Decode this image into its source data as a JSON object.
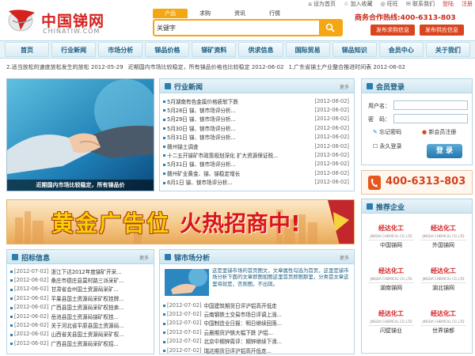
{
  "topbar": {
    "items": [
      "设为首页",
      "加入收藏",
      "旺旺",
      "联系我们",
      "登陆",
      "注册"
    ]
  },
  "logo": {
    "cn": "中国锑网",
    "en": "CHINATIW.COM"
  },
  "search": {
    "tabs": [
      "产品",
      "求购",
      "资讯",
      "行情"
    ],
    "value": "关键字"
  },
  "hotline": "商务合作热线:400-6313-803",
  "buttons": {
    "post_buy": "发布求购信息",
    "post_sell": "发布供应信息"
  },
  "nav": [
    "首页",
    "行业新闻",
    "市场分析",
    "锑品价格",
    "锑矿资料",
    "供求信息",
    "国际贸易",
    "锑品知识",
    "会员中心",
    "关于我们"
  ],
  "newsbar": [
    "2.适当放松的速度放松发生的放松 2012-05-29",
    "近期国内市场比较稳定，所有锑品价格也比较稳定 2012-06-02",
    "1.广东省锑土产业整合推进时间表 2012-06-02"
  ],
  "feature": {
    "caption": "近期国内市场比较稳定，所有锑品价"
  },
  "industry": {
    "title": "行业新闻",
    "more": "更多",
    "items": [
      {
        "t": "5月湖南有色金属价格疲软下跌",
        "d": "[2012-06-02]"
      },
      {
        "t": "5月28日 锑、镁市场评分析...",
        "d": "[2012-06-02]"
      },
      {
        "t": "5月29日 锑、镁市场评分析...",
        "d": "[2012-06-02]"
      },
      {
        "t": "5月30日 锑、镁市场评分析...",
        "d": "[2012-06-02]"
      },
      {
        "t": "5月31日 锑、镁市场评分析...",
        "d": "[2012-06-02]"
      },
      {
        "t": "赣州锑土调查",
        "d": "[2012-06-02]"
      },
      {
        "t": "十二五开锑矿市政策规划深化 扩大资源保证税...",
        "d": "[2012-06-02]"
      },
      {
        "t": "5月31日 锑、镁市场评分析...",
        "d": "[2012-06-02]"
      },
      {
        "t": "赣州矿业黄金、锑、锑稳定增长",
        "d": "[2012-06-02]"
      },
      {
        "t": "6月1日 锑、镁市场评分析...",
        "d": "[2012-06-02]"
      }
    ]
  },
  "member": {
    "title": "会员登录",
    "username_label": "用户名：",
    "password_label": "密　码：",
    "forgot": "忘记密码",
    "register": "新会员注册",
    "remember": "永久登录",
    "login": "登 录"
  },
  "phone": "400-6313-803",
  "banner": {
    "text1": "黄金广告位",
    "text2": "火热招商中!"
  },
  "recommend": {
    "title": "推荐企业",
    "logo_main": "经达化工",
    "logo_sub": "JINGDA CHEMICAL CO.,LTD",
    "companies": [
      "中国锑网",
      "外国锑网",
      "湖南锑网",
      "湖北锑网",
      "闪壁锑业",
      "世界锑都"
    ]
  },
  "bid": {
    "title": "招标信息",
    "more": "更多",
    "items": [
      {
        "d": "[2012-07-02]",
        "t": "浙江下达2012年度锑矿开采..."
      },
      {
        "d": "[2012-06-02]",
        "t": "桑庄市德庄县莫村路三派采矿..."
      },
      {
        "d": "[2012-06-02]",
        "t": "甘肃省会州国土资源局采矿..."
      },
      {
        "d": "[2012-06-02]",
        "t": "平果县国土资源局采矿权挂牌..."
      },
      {
        "d": "[2012-06-02]",
        "t": "广西县国土资源局采矿权拍卖..."
      },
      {
        "d": "[2012-06-02]",
        "t": "岳池县国土资源局锑矿权挂..."
      },
      {
        "d": "[2012-06-02]",
        "t": "关于河北省平原县国土资源局..."
      },
      {
        "d": "[2012-06-02]",
        "t": "山西省关县国土资源局采矿权..."
      },
      {
        "d": "[2012-06-02]",
        "t": "广西县国土资源局采矿权招..."
      }
    ]
  },
  "analysis": {
    "title": "锑市场分析",
    "more": "更多",
    "summary": "这是里锑市场的首页图文，文章属性勾选为首页，这里是锑市场分析下面的文章即图如图这里首页即图那里，分类首文章这里将就是，否则图，不出现。",
    "items": [
      {
        "d": "[2012-07-02]",
        "t": "中国建筑期货日评沪铝高开低走"
      },
      {
        "d": "[2012-07-02]",
        "t": "云南钢铁土交易市场日评调上涨..."
      },
      {
        "d": "[2012-07-02]",
        "t": "中国制造业日报：明日继续回落..."
      },
      {
        "d": "[2012-07-02]",
        "t": "云晨期货沪镁大幅下跌 沪铝..."
      },
      {
        "d": "[2012-07-02]",
        "t": "北京中期锌周评：期锌继续下滑..."
      },
      {
        "d": "[2012-07-02]",
        "t": "瑞达期货日评沪铝高开低走..."
      }
    ]
  }
}
